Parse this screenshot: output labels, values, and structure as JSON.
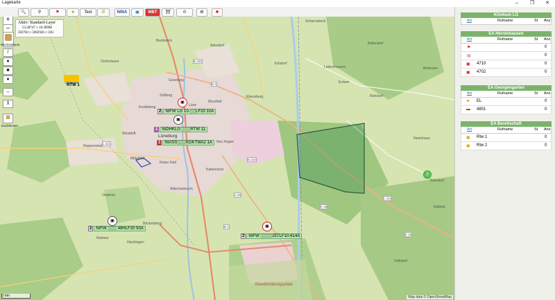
{
  "window": {
    "title": "Lagekarte",
    "min": "–",
    "max": "❐",
    "close": "✕"
  },
  "toolbar": {
    "text_label": "Text",
    "nina_label": "NINA",
    "mbt_label": "MBT",
    "refresh_label": "Refresh"
  },
  "map": {
    "zoom_in": "+",
    "zoom_out": "−",
    "info": {
      "line1": "Aktiv: Standard-Layer",
      "line2": "53.28747 ≡ 10.39998",
      "line3": "592702 ≡ 5902926 ≡ 32U"
    },
    "side_labels": {
      "wechsel": "Wechselraum",
      "dachfenster": "Dachfenster"
    },
    "places": [
      {
        "name": "Vögelsen"
      },
      {
        "name": "Ochtmissen"
      },
      {
        "name": "Bardowick"
      },
      {
        "name": "Kreideberg"
      },
      {
        "name": "Zeltberg"
      },
      {
        "name": "Goseburg"
      },
      {
        "name": "Lüne"
      },
      {
        "name": "Moorfeld"
      },
      {
        "name": "Ebensberg"
      },
      {
        "name": "Westduft"
      },
      {
        "name": "Lüneburg"
      },
      {
        "name": "Neu Hagen"
      },
      {
        "name": "Reppenstedt"
      },
      {
        "name": "Mittelfeld"
      },
      {
        "name": "Rotes Feld"
      },
      {
        "name": "Kaltenmoor"
      },
      {
        "name": "Wilschenbruch"
      },
      {
        "name": "Oedeme"
      },
      {
        "name": "Böckelsberg"
      },
      {
        "name": "Rettmer"
      },
      {
        "name": "Häcklingen"
      },
      {
        "name": "Adendorf"
      },
      {
        "name": "Erbstorf"
      },
      {
        "name": "Lüdershausen"
      },
      {
        "name": "Scharnebeck"
      },
      {
        "name": "Echem"
      },
      {
        "name": "Bullendorf"
      },
      {
        "name": "Rohstorf"
      },
      {
        "name": "Boltersen"
      },
      {
        "name": "Neetzhaus"
      },
      {
        "name": "Reinstorf"
      },
      {
        "name": "Volkstorf"
      },
      {
        "name": "Eilabek"
      },
      {
        "name": "Standortübungsplatz"
      }
    ],
    "roads": [
      "B 209",
      "B 4",
      "B 216",
      "L 221",
      "A 39",
      "K 46",
      "K 36",
      "L 216",
      "B 4"
    ],
    "units": [
      {
        "label": "RTW 1"
      },
      {
        "num": "2",
        "text": "NIFW LG 10-░░LF20 10A"
      },
      {
        "num": "1",
        "text": "NIDHKLG ░░░RTW 11"
      },
      {
        "num": "1",
        "text": "NIASS░░░KDKTWA2 1A"
      },
      {
        "num": "2",
        "text": "NIFW ░░░ 48HLF20 50A"
      },
      {
        "num": "2",
        "text": "NIFW ░░░░25TLF10-614A"
      }
    ],
    "cluster_count": "2",
    "attribution": "Map data © OpenStreetMap",
    "scale_label": "1 km"
  },
  "panel": {
    "sections": [
      {
        "title": "Klinikum LG",
        "cols": {
          "art": "Art",
          "rufname": "Rufname",
          "st": "St",
          "anz": "Anz"
        },
        "rows": []
      },
      {
        "title": "EA Herrenhausen",
        "cols": {
          "art": "Art",
          "rufname": "Rufname",
          "st": "St",
          "anz": "Anz"
        },
        "rows": [
          {
            "icon": "fire-station-icon",
            "rufname": "",
            "anz": "0"
          },
          {
            "icon": "hatch-icon",
            "rufname": "",
            "anz": "0"
          },
          {
            "icon": "fire-truck-icon",
            "rufname": "4710",
            "anz": "0"
          },
          {
            "icon": "fire-truck-icon",
            "rufname": "4702",
            "anz": "0"
          }
        ]
      },
      {
        "title": "EA Georgengarten",
        "cols": {
          "art": "Art",
          "rufname": "Rufname",
          "st": "St",
          "anz": "Anz"
        },
        "rows": [
          {
            "icon": "command-flag-icon",
            "rufname": "EL",
            "anz": "0"
          },
          {
            "icon": "ladder-truck-icon",
            "rufname": "4801",
            "anz": "0"
          }
        ]
      },
      {
        "title": "EA Bereitschaft",
        "cols": {
          "art": "Art",
          "rufname": "Rufname",
          "st": "St",
          "anz": "Anz"
        },
        "rows": [
          {
            "icon": "ambulance-icon",
            "rufname": "Rtw 1",
            "anz": "0"
          },
          {
            "icon": "ambulance-icon",
            "rufname": "Rtw 2",
            "anz": "0"
          }
        ]
      }
    ]
  },
  "colors": {
    "section_header": "#7cb36b",
    "area_polygon": "#2d7a44",
    "unit_label_bg": "#b5e6a8"
  }
}
